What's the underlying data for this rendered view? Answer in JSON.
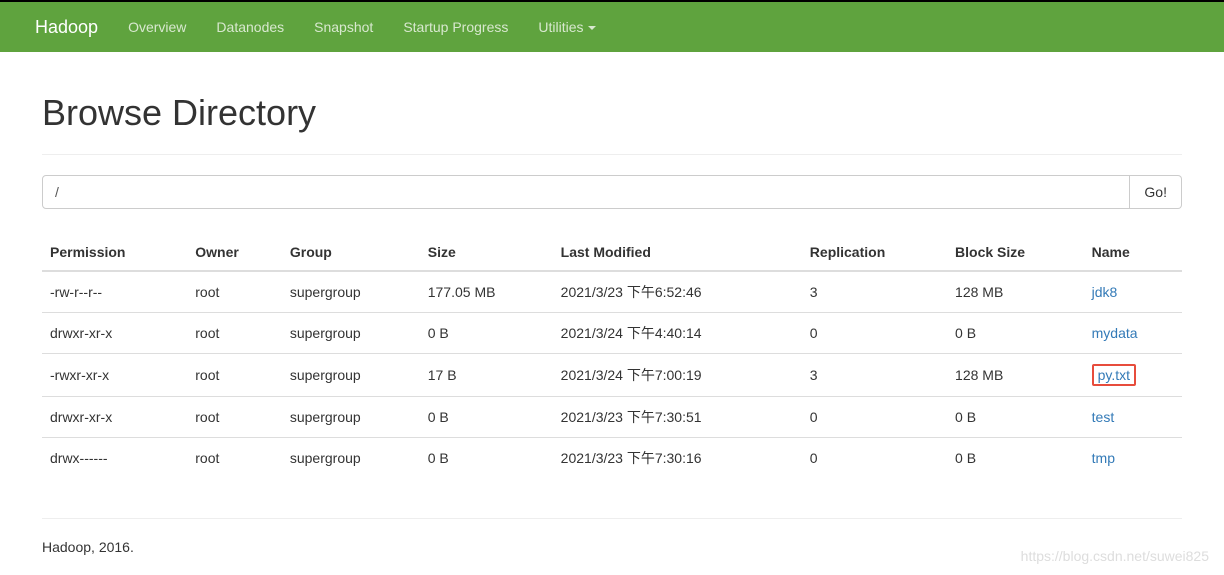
{
  "navbar": {
    "brand": "Hadoop",
    "items": [
      "Overview",
      "Datanodes",
      "Snapshot",
      "Startup Progress",
      "Utilities"
    ]
  },
  "page_title": "Browse Directory",
  "path_input": {
    "value": "/"
  },
  "go_button": "Go!",
  "table": {
    "headers": [
      "Permission",
      "Owner",
      "Group",
      "Size",
      "Last Modified",
      "Replication",
      "Block Size",
      "Name"
    ],
    "rows": [
      {
        "permission": "-rw-r--r--",
        "owner": "root",
        "group": "supergroup",
        "size": "177.05 MB",
        "modified": "2021/3/23 下午6:52:46",
        "replication": "3",
        "block_size": "128 MB",
        "name": "jdk8",
        "highlight": false
      },
      {
        "permission": "drwxr-xr-x",
        "owner": "root",
        "group": "supergroup",
        "size": "0 B",
        "modified": "2021/3/24 下午4:40:14",
        "replication": "0",
        "block_size": "0 B",
        "name": "mydata",
        "highlight": false
      },
      {
        "permission": "-rwxr-xr-x",
        "owner": "root",
        "group": "supergroup",
        "size": "17 B",
        "modified": "2021/3/24 下午7:00:19",
        "replication": "3",
        "block_size": "128 MB",
        "name": "py.txt",
        "highlight": true
      },
      {
        "permission": "drwxr-xr-x",
        "owner": "root",
        "group": "supergroup",
        "size": "0 B",
        "modified": "2021/3/23 下午7:30:51",
        "replication": "0",
        "block_size": "0 B",
        "name": "test",
        "highlight": false
      },
      {
        "permission": "drwx------",
        "owner": "root",
        "group": "supergroup",
        "size": "0 B",
        "modified": "2021/3/23 下午7:30:16",
        "replication": "0",
        "block_size": "0 B",
        "name": "tmp",
        "highlight": false
      }
    ]
  },
  "footer": "Hadoop, 2016.",
  "watermark": "https://blog.csdn.net/suwei825"
}
